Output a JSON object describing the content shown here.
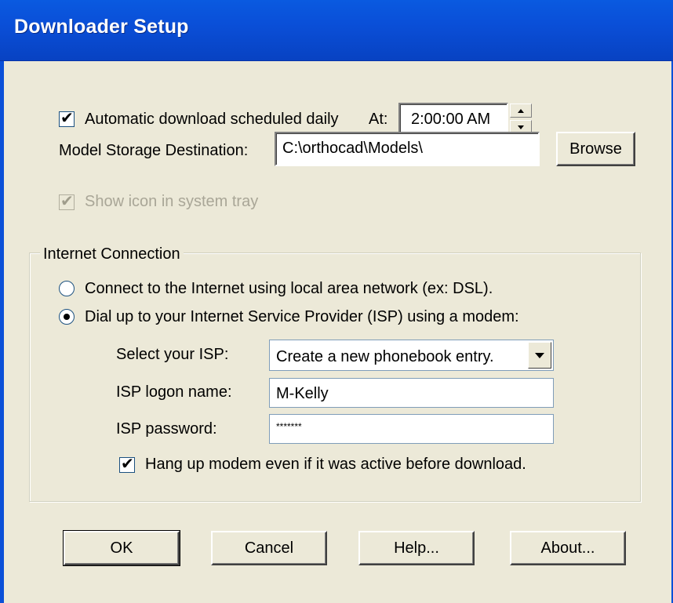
{
  "window": {
    "title": "Downloader Setup"
  },
  "schedule": {
    "checkbox_label": "Automatic download scheduled daily",
    "checked": true,
    "at_label": "At:",
    "time_value": "2:00:00 AM"
  },
  "storage": {
    "label": "Model Storage Destination:",
    "path_value": "C:\\orthocad\\Models\\",
    "browse_label": "Browse"
  },
  "tray": {
    "label": "Show icon in system tray",
    "checked": true,
    "enabled": false
  },
  "internet": {
    "group_label": "Internet Connection",
    "lan_label": "Connect to the Internet using local area network (ex: DSL).",
    "dialup_label": "Dial up to your Internet Service Provider (ISP) using a modem:",
    "selected": "dialup",
    "isp_select_label": "Select your ISP:",
    "isp_select_value": "Create a new phonebook entry.",
    "logon_label": "ISP logon name:",
    "logon_value": "M-Kelly",
    "password_label": "ISP password:",
    "password_value": "*******",
    "hangup_label": "Hang up modem even if it was active before download.",
    "hangup_checked": true
  },
  "buttons": {
    "ok": "OK",
    "cancel": "Cancel",
    "help": "Help...",
    "about": "About..."
  },
  "icons": {
    "check": "check-icon",
    "spin_up": "arrow-up-icon",
    "spin_down": "arrow-down-icon",
    "dropdown": "chevron-down-icon"
  },
  "colors": {
    "titlebar": "#0a4fd8",
    "dialog_bg": "#ece9d8",
    "disabled_text": "#a9a697"
  }
}
